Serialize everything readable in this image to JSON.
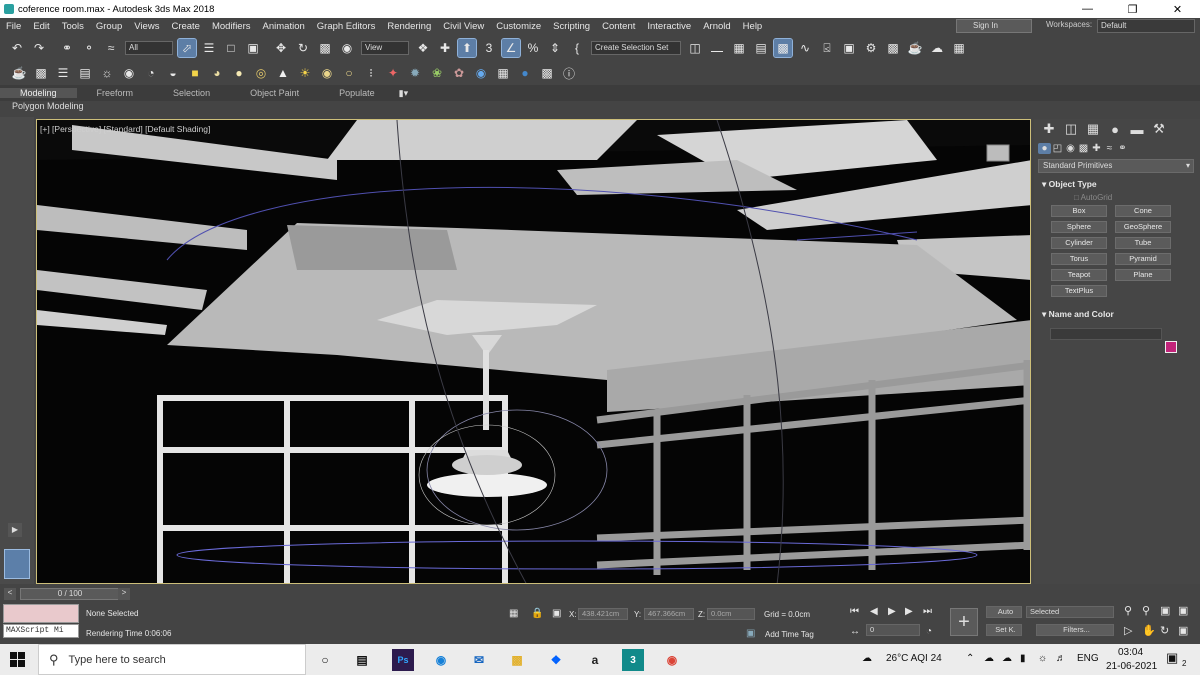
{
  "window": {
    "title": "coference room.max - Autodesk 3ds Max 2018"
  },
  "menu": [
    "File",
    "Edit",
    "Tools",
    "Group",
    "Views",
    "Create",
    "Modifiers",
    "Animation",
    "Graph Editors",
    "Rendering",
    "Civil View",
    "Customize",
    "Scripting",
    "Content",
    "Interactive",
    "Arnold",
    "Help"
  ],
  "signin": "Sign In",
  "workspaces_label": "Workspaces:",
  "workspace_value": "Default",
  "toolbar": {
    "filter": "All",
    "ref_coord": "View",
    "selection_set": "Create Selection Set"
  },
  "ribbon": {
    "tabs": [
      "Modeling",
      "Freeform",
      "Selection",
      "Object Paint",
      "Populate"
    ],
    "sub": "Polygon Modeling"
  },
  "viewport": {
    "label": "[+] [Perspective] [Standard] [Default Shading]"
  },
  "command_panel": {
    "dropdown": "Standard Primitives",
    "object_type": "Object Type",
    "autogrid": "AutoGrid",
    "buttons": [
      "Box",
      "Cone",
      "Sphere",
      "GeoSphere",
      "Cylinder",
      "Tube",
      "Torus",
      "Pyramid",
      "Teapot",
      "Plane",
      "TextPlus"
    ],
    "name_and_color": "Name and Color",
    "color": "#c2247a"
  },
  "status": {
    "frame": "0 / 100",
    "none_selected": "None Selected",
    "rendering_time": "Rendering Time  0:06:06",
    "maxscript": "MAXScript Mi",
    "x_label": "X:",
    "x_value": "438.421cm",
    "y_label": "Y:",
    "y_value": "467.366cm",
    "z_label": "Z:",
    "z_value": "0.0cm",
    "grid": "Grid = 0.0cm",
    "add_time_tag": "Add Time Tag",
    "auto": "Auto",
    "selected": "Selected",
    "setk": "Set K.",
    "filters": "Filters...",
    "frame_field": "0"
  },
  "taskbar": {
    "search_placeholder": "Type here to search",
    "weather": "26°C  AQI 24",
    "lang": "ENG",
    "time": "03:04",
    "date": "21-06-2021",
    "notif": "2"
  }
}
